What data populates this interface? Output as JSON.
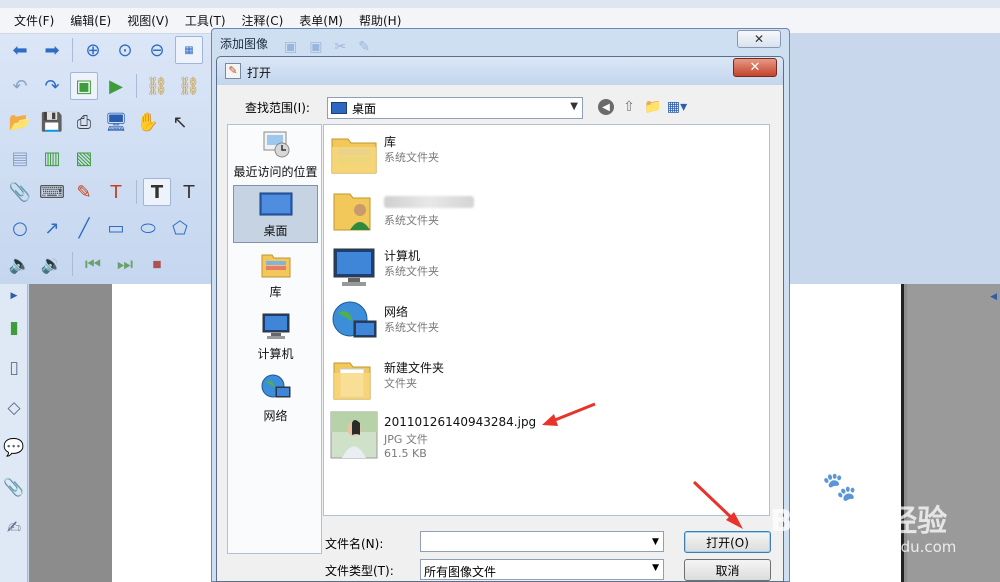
{
  "menu": [
    "文件(F)",
    "编辑(E)",
    "视图(V)",
    "工具(T)",
    "注释(C)",
    "表单(M)",
    "帮助(H)"
  ],
  "outer_dialog": {
    "title": "添加图像"
  },
  "open_dialog": {
    "title": "打开",
    "close_glyph": "✕",
    "lookin_label": "查找范围(I):",
    "lookin_value": "桌面",
    "places": [
      {
        "label": "最近访问的位置",
        "icon": "recent-places-icon"
      },
      {
        "label": "桌面",
        "icon": "desktop-icon",
        "selected": true
      },
      {
        "label": "库",
        "icon": "libraries-icon"
      },
      {
        "label": "计算机",
        "icon": "computer-icon"
      },
      {
        "label": "网络",
        "icon": "network-icon"
      }
    ],
    "files": [
      {
        "name": "库",
        "type": "系统文件夹",
        "icon": "libraries-folder-icon"
      },
      {
        "name": "",
        "type": "系统文件夹",
        "icon": "user-folder-icon",
        "name_blurred": true
      },
      {
        "name": "计算机",
        "type": "系统文件夹",
        "icon": "computer-icon"
      },
      {
        "name": "网络",
        "type": "系统文件夹",
        "icon": "network-icon"
      },
      {
        "name": "新建文件夹",
        "type": "文件夹",
        "icon": "folder-icon"
      },
      {
        "name": "20110126140943284.jpg",
        "type": "JPG 文件",
        "size": "61.5 KB",
        "icon": "jpg-thumbnail-icon"
      }
    ],
    "filename_label": "文件名(N):",
    "filename_value": "",
    "filetype_label": "文件类型(T):",
    "filetype_value": "所有图像文件",
    "open_button": "打开(O)",
    "cancel_button": "取消"
  },
  "watermark": {
    "brand": "Bai du 经验",
    "url": "jingyan.baidu.com"
  },
  "colors": {
    "annotation_arrow": "#e8322a",
    "selected_place": "#c6d3e3",
    "close_button": "#c4432b"
  }
}
